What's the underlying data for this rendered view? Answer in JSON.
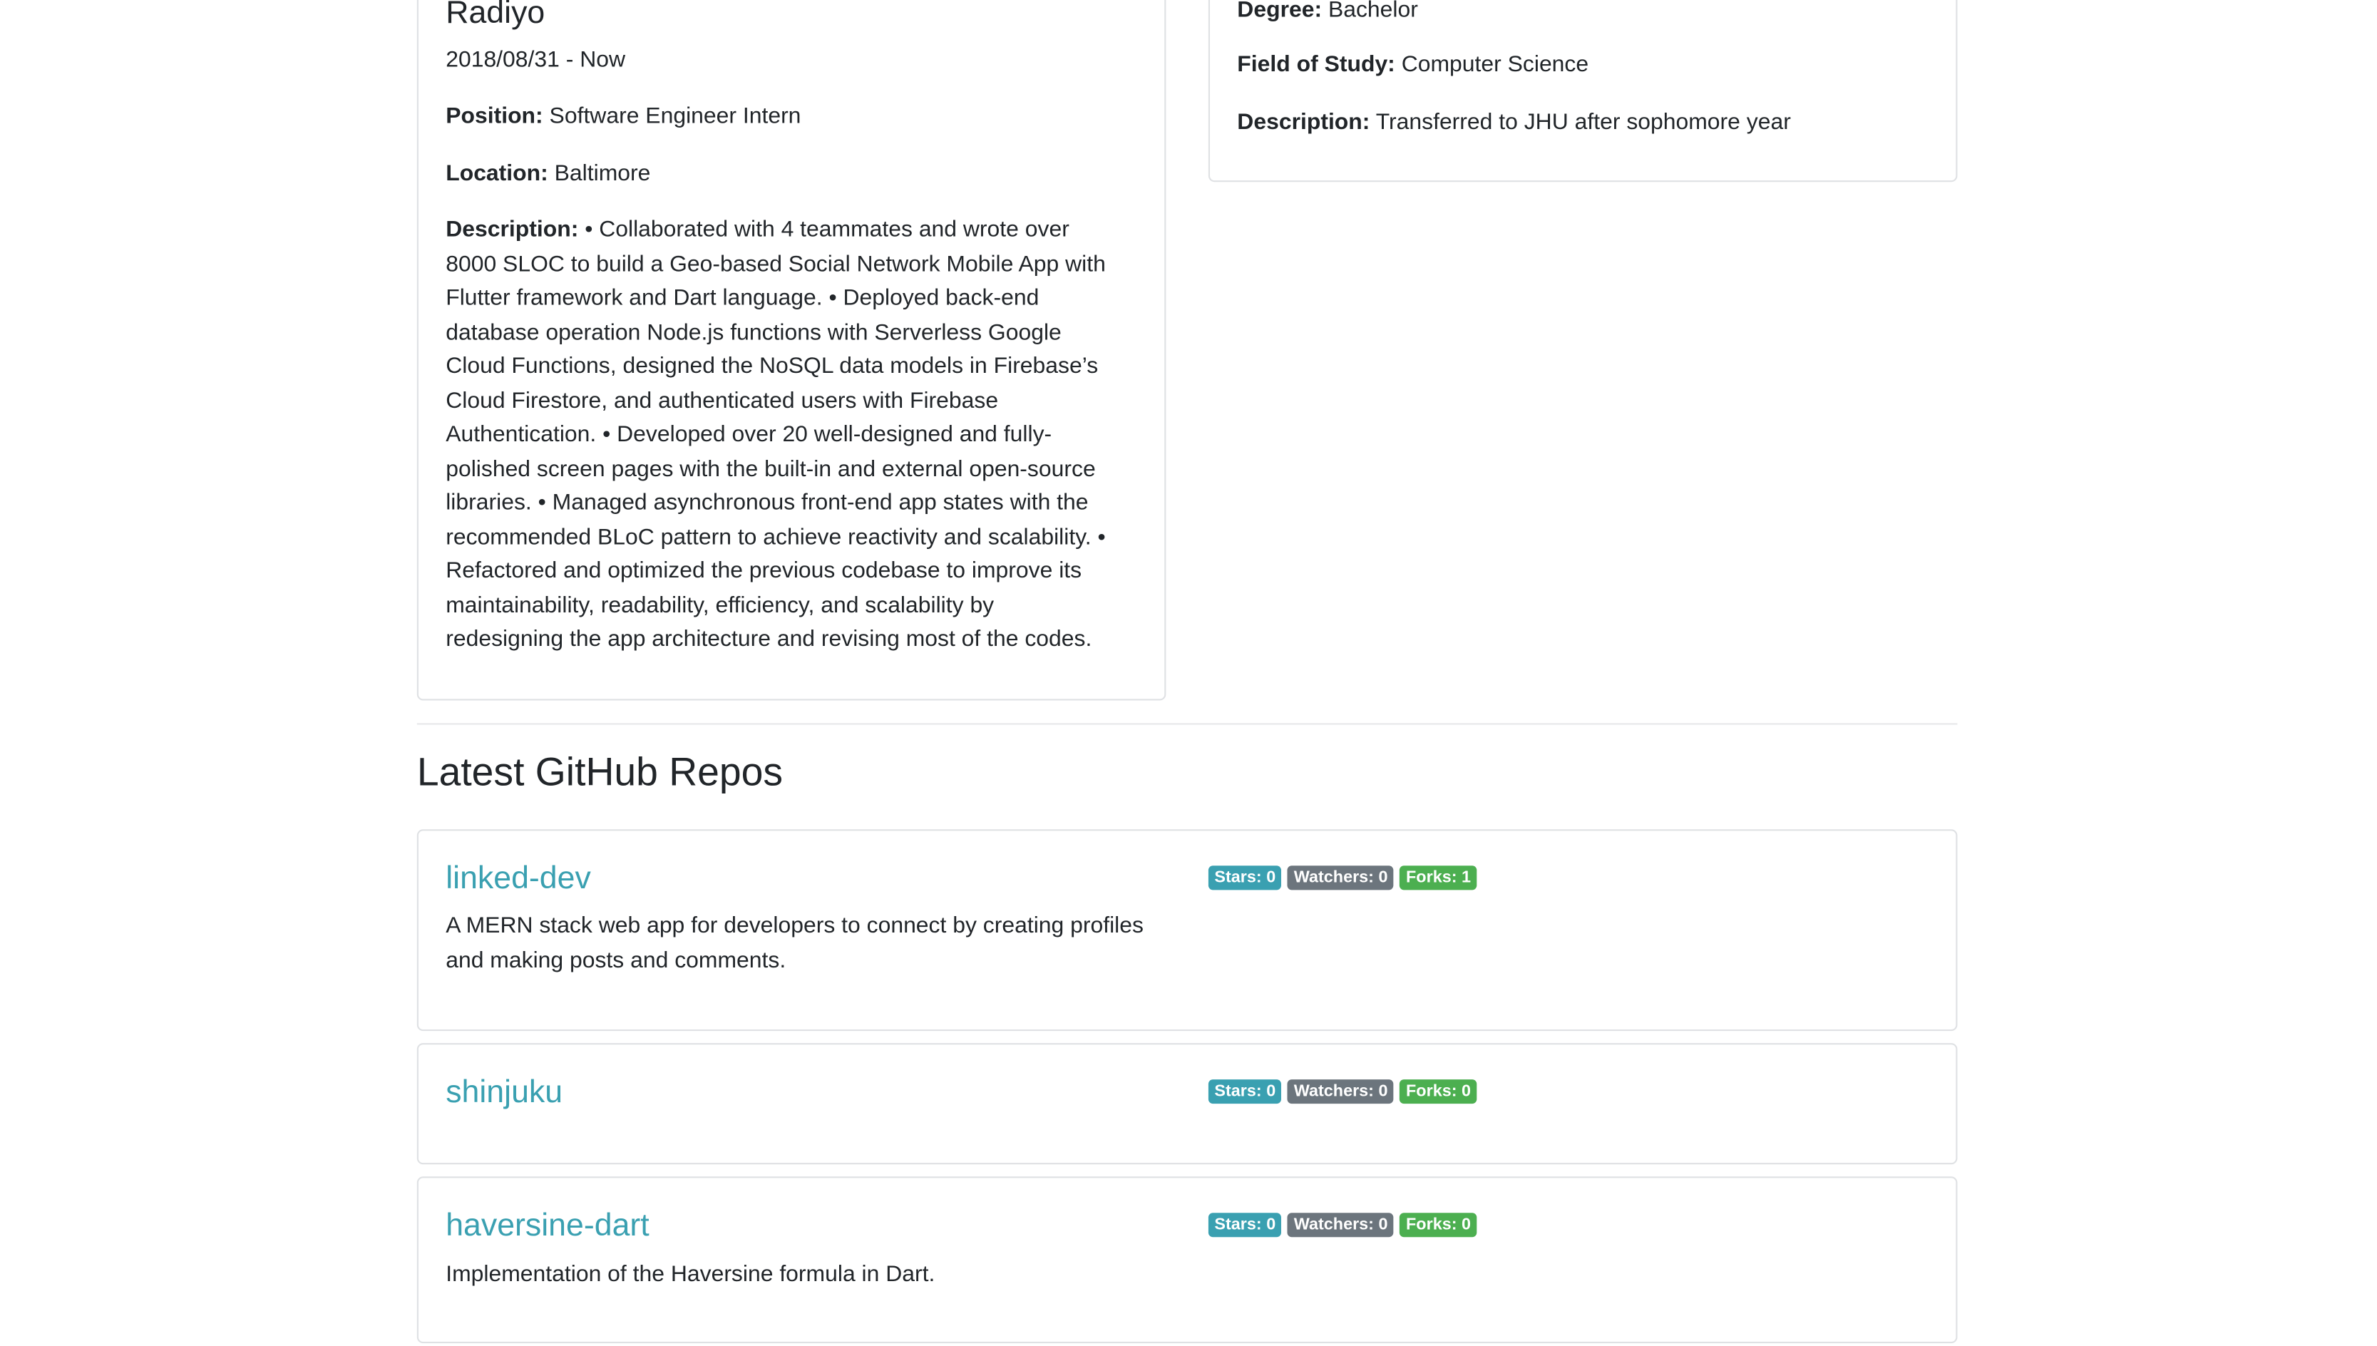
{
  "experience": {
    "company": "Radiyo",
    "dates": "2018/08/31 - Now",
    "position_label": "Position:",
    "position_value": "Software Engineer Intern",
    "location_label": "Location:",
    "location_value": "Baltimore",
    "description_label": "Description:",
    "description_lines": [
      "• Collaborated with 4 teammates and wrote over",
      "8000 SLOC to build a Geo-based Social Network Mobile App with",
      "Flutter framework and Dart language. • Deployed back-end",
      "database operation Node.js functions with Serverless Google",
      "Cloud Functions, designed the NoSQL data models in Firebase’s",
      "Cloud Firestore, and authenticated users with Firebase",
      "Authentication. • Developed over 20 well-designed and fully-",
      "polished screen pages with the built-in and external open-source",
      "libraries. • Managed asynchronous front-end app states with the",
      "recommended BLoC pattern to achieve reactivity and scalability. •",
      "Refactored and optimized the previous codebase to improve its",
      "maintainability, readability, efficiency, and scalability by",
      "redesigning the app architecture and revising most of the codes."
    ]
  },
  "education": {
    "degree_label": "Degree:",
    "degree_value": "Bachelor",
    "field_label": "Field of Study:",
    "field_value": "Computer Science",
    "description_label": "Description:",
    "description_value": "Transferred to JHU after sophomore year"
  },
  "repos_section": {
    "title": "Latest GitHub Repos"
  },
  "repos": [
    {
      "name": "linked-dev",
      "description_lines": [
        "A MERN stack web app for developers to connect by creating profiles",
        "and making posts and comments."
      ],
      "stars": "Stars: 0",
      "watchers": "Watchers: 0",
      "forks": "Forks: 1"
    },
    {
      "name": "shinjuku",
      "description_lines": [],
      "stars": "Stars: 0",
      "watchers": "Watchers: 0",
      "forks": "Forks: 0"
    },
    {
      "name": "haversine-dart",
      "description_lines": [
        "Implementation of the Haversine formula in Dart."
      ],
      "stars": "Stars: 0",
      "watchers": "Watchers: 0",
      "forks": "Forks: 0"
    }
  ],
  "colors": {
    "link": "#3aa0b1",
    "badge_stars": "#3aa0b1",
    "badge_watchers": "#6c757d",
    "badge_forks": "#4caf50"
  }
}
